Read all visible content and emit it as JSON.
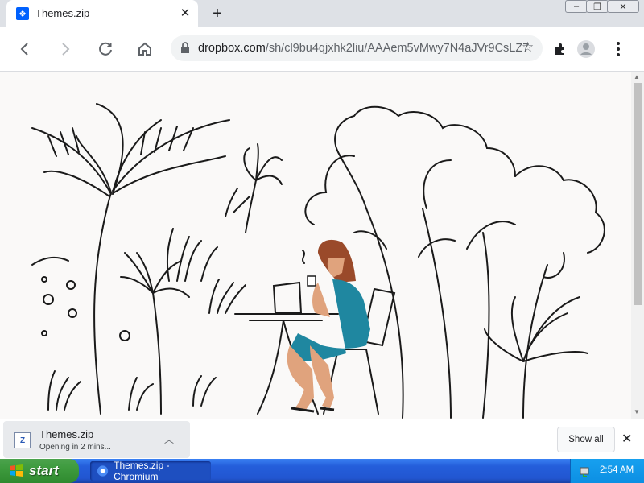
{
  "tab": {
    "title": "Themes.zip",
    "favicon": "dropbox-icon",
    "close_symbol": "✕"
  },
  "new_tab_symbol": "+",
  "window_controls": [
    "minimize",
    "restore",
    "close"
  ],
  "toolbar": {
    "url_host": "dropbox.com",
    "url_path": "/sh/cl9bu4qjxhk2liu/AAAem5vMwy7N4aJVr9CsLZ7"
  },
  "download": {
    "filename": "Themes.zip",
    "status": "Opening in 2 mins...",
    "show_all_label": "Show all"
  },
  "taskbar": {
    "start_label": "start",
    "task_label": "Themes.zip - Chromium",
    "clock": "2:54 AM"
  },
  "colors": {
    "accent": "#0061fe",
    "dress": "#1f87a0",
    "hair": "#9a4a2a"
  }
}
